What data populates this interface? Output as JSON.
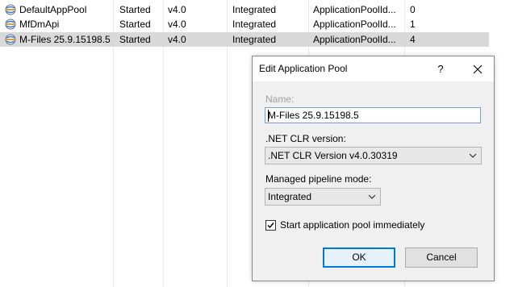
{
  "list": {
    "rows": [
      {
        "name": "DefaultAppPool",
        "status": "Started",
        "clr": "v4.0",
        "pipeline": "Integrated",
        "identity": "ApplicationPoolId...",
        "apps": "0"
      },
      {
        "name": "MfDmApi",
        "status": "Started",
        "clr": "v4.0",
        "pipeline": "Integrated",
        "identity": "ApplicationPoolId...",
        "apps": "1"
      },
      {
        "name": "M-Files 25.9.15198.5",
        "status": "Started",
        "clr": "v4.0",
        "pipeline": "Integrated",
        "identity": "ApplicationPoolId...",
        "apps": "4"
      }
    ],
    "selected_index": 2,
    "row_icon": "app-pool-icon"
  },
  "dialog": {
    "title": "Edit Application Pool",
    "help_label": "?",
    "close_icon": "close-icon",
    "name_label": "Name:",
    "name_value": "M-Files 25.9.15198.5",
    "clr_label": ".NET CLR version:",
    "clr_value": ".NET CLR Version v4.0.30319",
    "pipeline_label": "Managed pipeline mode:",
    "pipeline_value": "Integrated",
    "start_label": "Start application pool immediately",
    "start_checked": true,
    "ok_label": "OK",
    "cancel_label": "Cancel"
  },
  "colors": {
    "selection": "#d9d9d9",
    "dialog_bg": "#f0f0f0",
    "default_button_border": "#0078d7",
    "focus_border": "#7a9cc9"
  }
}
